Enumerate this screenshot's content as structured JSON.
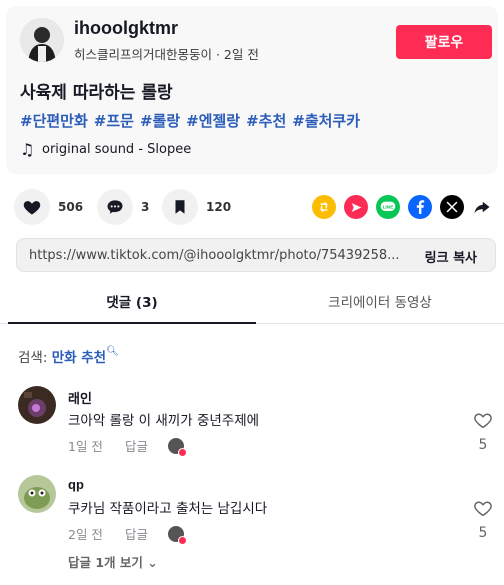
{
  "post": {
    "author": "ihooolgktmr",
    "subline": "히스클리프의거대한몽둥이 · 2일 전",
    "follow_label": "팔로우",
    "title": "사육제 따라하는 롤랑",
    "hashtags": [
      "#단편만화",
      "#프문",
      "#롤랑",
      "#엔젤랑",
      "#추천",
      "#출처쿠카"
    ],
    "sound": "original sound - Slopee"
  },
  "actions": {
    "likes": "506",
    "comments": "3",
    "saves": "120",
    "share_icons": [
      "repost-icon",
      "send-icon",
      "line-icon",
      "facebook-icon",
      "x-icon",
      "share-arrow-icon"
    ]
  },
  "link": {
    "url": "https://www.tiktok.com/@ihooolgktmr/photo/75439258...",
    "copy_label": "링크 복사"
  },
  "tabs": {
    "comments": "댓글 (3)",
    "creator_videos": "크리에이터 동영상"
  },
  "search": {
    "prefix": "검색: ",
    "query": "만화 추천"
  },
  "comments": [
    {
      "name": "래인",
      "text": "크아악 롤랑 이 새끼가 중년주제에",
      "time": "1일 전",
      "reply": "답글",
      "likes": "5"
    },
    {
      "name": "qp",
      "text": "쿠카님 작품이라고 출처는 남깁시다",
      "time": "2일 전",
      "reply": "답글",
      "likes": "5"
    }
  ],
  "view_replies": "답글 1개 보기",
  "colors": {
    "accent": "#fe2c55",
    "hashtag": "#2b5db9"
  }
}
